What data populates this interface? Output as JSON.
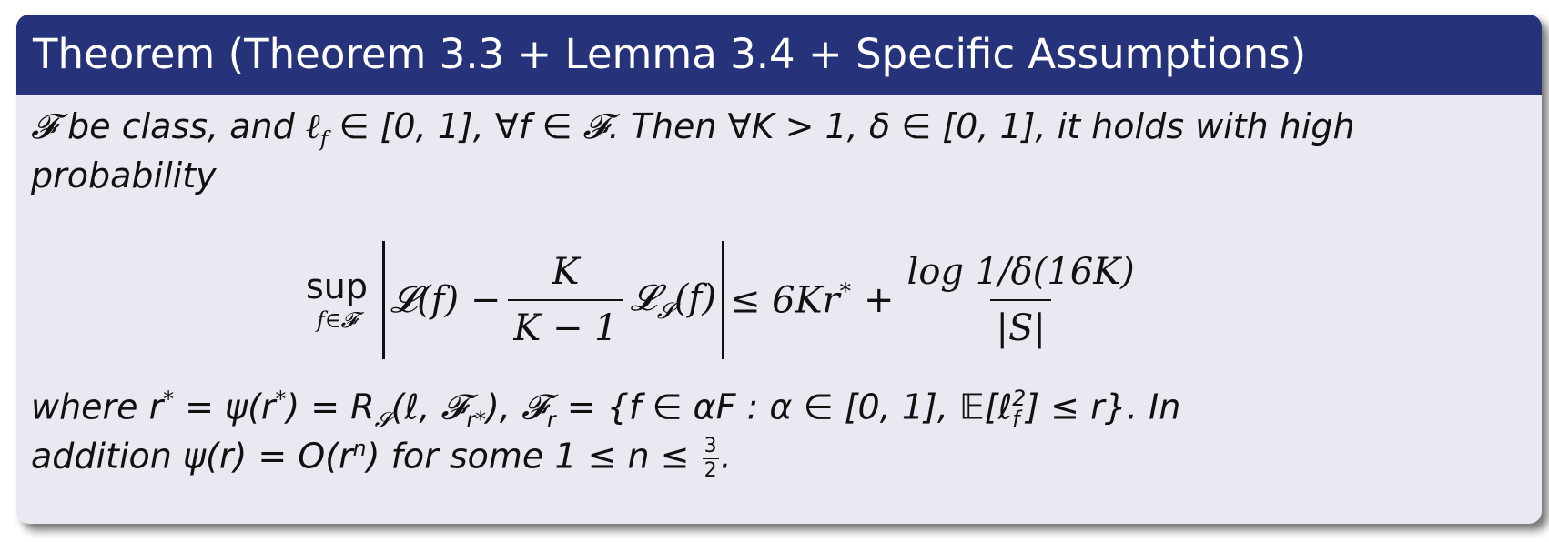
{
  "block": {
    "title": "Theorem (Theorem 3.3 + Lemma 3.4 + Specific Assumptions)"
  },
  "statement": {
    "calF": "𝓕",
    "intro_part1": " be class, and ",
    "ell_f": "ℓ",
    "ell_sub": "f",
    "intro_part2": " ∈ [0, 1], ∀f ∈ ",
    "intro_part3": ". Then ∀K > 1, δ ∈ [0, 1], it holds with high",
    "intro_line2": "probability"
  },
  "equation": {
    "sup_op": "sup",
    "sup_sub": "f∈𝓕",
    "lhs_L": "𝓛(f) −",
    "frac_num": "K",
    "frac_den": "K − 1",
    "lhs_LS": "𝓛",
    "lhs_LS_sub": "𝓢",
    "lhs_LS_arg": "(f)",
    "rel": "≤ 6Kr",
    "rel_sup": "*",
    "plus": "+",
    "rhs_num": "log 1/δ(16K)",
    "rhs_den": "|S|"
  },
  "conditions": {
    "line1_a": "where r",
    "line1_star": "*",
    "line1_b": " = ψ(r",
    "line1_star2": "*",
    "line1_c": ") = R",
    "line1_RS_sub": "𝓢",
    "line1_d": "(ℓ, 𝓕",
    "line1_Fsub": "r*",
    "line1_e": "), 𝓕",
    "line1_Fr_sub": "r",
    "line1_f": " = {f ∈ αF : α ∈ [0, 1], 𝔼[ℓ",
    "line1_ell_sup": "2",
    "line1_ell_sub": "f",
    "line1_g": "] ≤ r}.  In",
    "line2_a": "addition ψ(r) = O(r",
    "line2_sup": "n",
    "line2_b": ") for some 1 ≤ n ≤ ",
    "line2_frac_num": "3",
    "line2_frac_den": "2",
    "line2_end": "."
  }
}
